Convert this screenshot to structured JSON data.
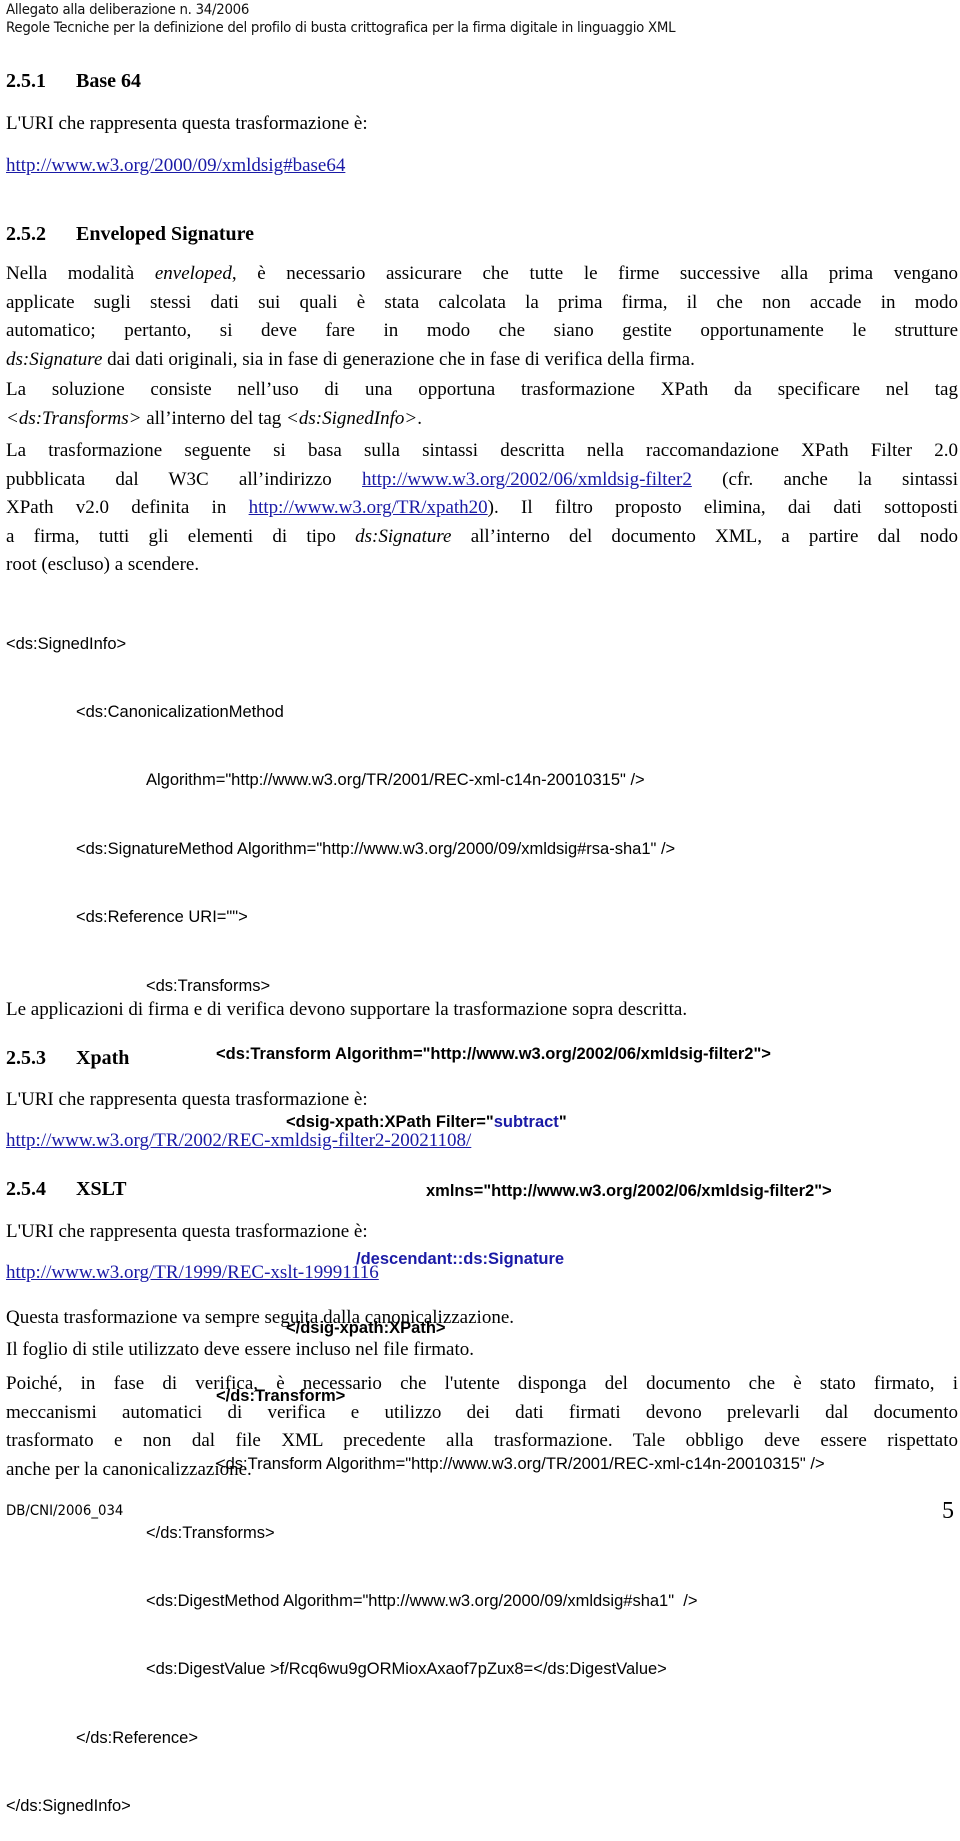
{
  "header": {
    "line1": "Allegato alla deliberazione n. 34/2006",
    "line2": "Regole Tecniche per la definizione del profilo di busta crittografica per la firma digitale in linguaggio XML"
  },
  "section_251": {
    "number": "2.5.1",
    "title": "Base 64",
    "uri_intro": "L'URI che rappresenta questa trasformazione è:",
    "uri": "http://www.w3.org/2000/09/xmldsig#base64"
  },
  "section_252": {
    "number": "2.5.2",
    "title": "Enveloped Signature",
    "para1": {
      "lines": [
        [
          "Nella modalità ",
          "enveloped",
          ", è necessario assicurare che tutte le firme successive alla prima vengano"
        ],
        [
          "applicate sugli stessi dati sui quali è stata calcolata la prima firma, il che non accade in modo"
        ],
        [
          "automatico; pertanto, si deve fare in modo che siano gestite opportunamente le strutture"
        ],
        [
          "ds:Signature",
          " dai dati originali, sia in fase di generazione che in fase di verifica della firma."
        ]
      ]
    },
    "para2": {
      "line1": "La soluzione consiste nell’uso di una opportuna trasformazione XPath da specificare nel tag",
      "line2_tag1": "<ds:Transforms>",
      "line2_mid": " all’interno del tag ",
      "line2_tag2": "<ds:SignedInfo>",
      "line2_end": "."
    },
    "para3": {
      "line1": "La trasformazione seguente si basa sulla sintassi descritta nella raccomandazione XPath Filter 2.0",
      "line2_pre": "pubblicata dal W3C all’indirizzo ",
      "line2_link": "http://www.w3.org/2002/06/xmldsig-filter2",
      "line2_post": " (cfr. anche la sintassi",
      "line3_pre": "XPath v2.0 definita in ",
      "line3_link": "http://www.w3.org/TR/xpath20",
      "line3_post": "). Il filtro proposto elimina, dai dati sottoposti",
      "line4_pre": "a firma, tutti gli elementi di tipo ",
      "line4_em": "ds:Signature",
      "line4_post": " all’interno del documento XML, a partire dal nodo",
      "line5": "root (escluso) a scendere."
    },
    "code": {
      "l1": "<ds:SignedInfo>",
      "l2": "<ds:CanonicalizationMethod",
      "l3": "Algorithm=\"http://www.w3.org/TR/2001/REC-xml-c14n-20010315\" />",
      "l4": "<ds:SignatureMethod Algorithm=\"http://www.w3.org/2000/09/xmldsig#rsa-sha1\" />",
      "l5": "<ds:Reference URI=\"\">",
      "l6": "<ds:Transforms>",
      "l7": "<ds:Transform Algorithm=\"http://www.w3.org/2002/06/xmldsig-filter2\">",
      "l8_pre": "<dsig-xpath:XPath Filter=\"",
      "l8_val": "subtract",
      "l8_post": "\"",
      "l9": "xmlns=\"http://www.w3.org/2002/06/xmldsig-filter2\">",
      "l10": "/descendant::ds:Signature",
      "l11": "</dsig-xpath:XPath>",
      "l12": "</ds:Transform>",
      "l13": "<ds:Transform Algorithm=\"http://www.w3.org/TR/2001/REC-xml-c14n-20010315\" />",
      "l14": "</ds:Transforms>",
      "l15": "<ds:DigestMethod Algorithm=\"http://www.w3.org/2000/09/xmldsig#sha1\"  />",
      "l16": "<ds:DigestValue >f/Rcq6wu9gORMioxAxaof7pZux8=</ds:DigestValue>",
      "l17": "</ds:Reference>",
      "l18": "</ds:SignedInfo>"
    },
    "closing": "Le applicazioni di firma e di verifica devono supportare la trasformazione sopra descritta."
  },
  "section_253": {
    "number": "2.5.3",
    "title": "Xpath",
    "uri_intro": "L'URI che rappresenta questa trasformazione è:",
    "uri": "http://www.w3.org/TR/2002/REC-xmldsig-filter2-20021108/"
  },
  "section_254": {
    "number": "2.5.4",
    "title": "XSLT",
    "uri_intro": "L'URI che rappresenta questa trasformazione è:",
    "uri": "http://www.w3.org/TR/1999/REC-xslt-19991116",
    "note1": "Questa trasformazione va sempre seguita dalla canonicalizzazione.",
    "note2": "Il foglio di stile utilizzato deve essere incluso nel file firmato.",
    "para": [
      "Poiché, in fase di verifica, è necessario che l'utente disponga del documento che è stato firmato, i",
      "meccanismi automatici di verifica e utilizzo dei dati firmati devono prelevarli dal documento",
      "trasformato e non dal file XML precedente alla trasformazione. Tale obbligo deve essere rispettato",
      "anche per la canonicalizzazione."
    ]
  },
  "footer": {
    "doc_id": "DB/CNI/2006_034",
    "page_number": "5"
  },
  "colors": {
    "link": "#1a1aa6",
    "code_highlight": "#1a1aa6",
    "text": "#000000"
  }
}
